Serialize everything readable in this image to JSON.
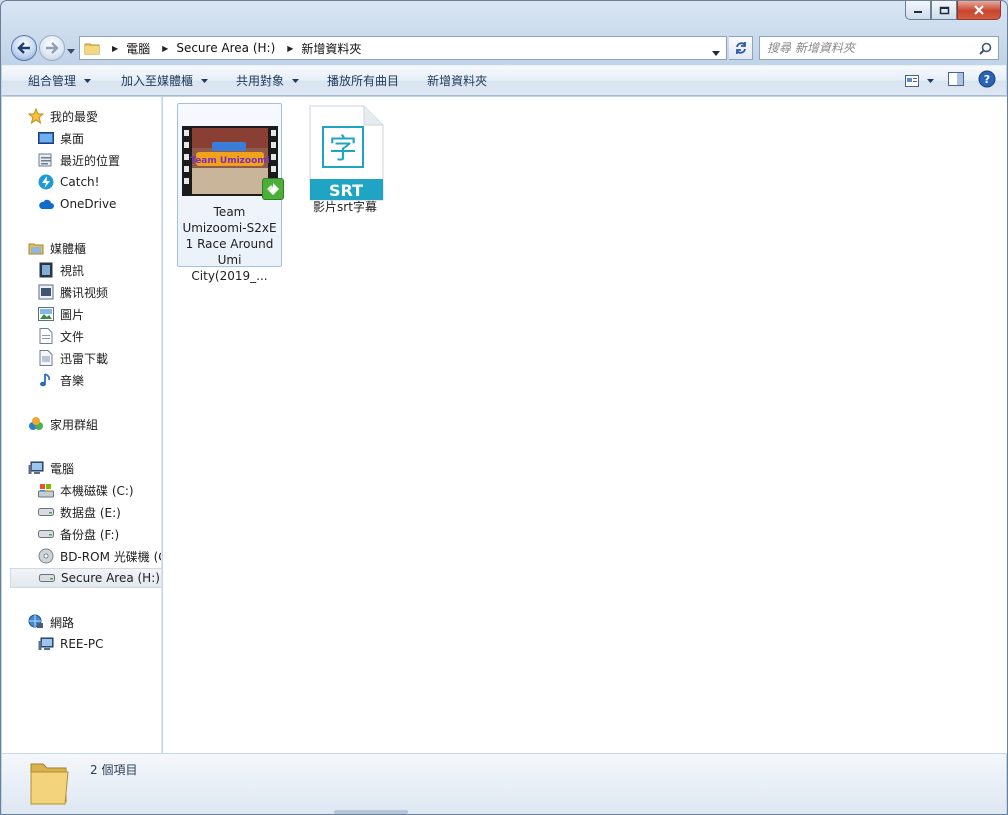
{
  "window": {
    "caption_buttons": [
      "minimize",
      "maximize",
      "close"
    ]
  },
  "address_bar": {
    "breadcrumbs": [
      "電腦",
      "Secure Area (H:)",
      "新增資料夾"
    ]
  },
  "search": {
    "placeholder": "搜尋 新增資料夾"
  },
  "toolbar": {
    "organize": "組合管理",
    "include_in_library": "加入至媒體櫃",
    "share_with": "共用對象",
    "play_all": "播放所有曲目",
    "new_folder": "新增資料夾"
  },
  "sidebar": {
    "favorites": {
      "label": "我的最愛",
      "items": [
        "桌面",
        "最近的位置",
        "Catch!",
        "OneDrive"
      ]
    },
    "libraries": {
      "label": "媒體櫃",
      "items": [
        "視訊",
        "騰讯视频",
        "圖片",
        "文件",
        "迅雷下載",
        "音樂"
      ]
    },
    "homegroup": {
      "label": "家用群組"
    },
    "computer": {
      "label": "電腦",
      "items": [
        "本機磁碟 (C:)",
        "数据盘 (E:)",
        "备份盘 (F:)",
        "BD-ROM 光碟機 (G:)",
        "Secure Area (H:)"
      ]
    },
    "network": {
      "label": "網路",
      "items": [
        "REE-PC"
      ]
    },
    "selected": "Secure Area (H:)"
  },
  "files": [
    {
      "name_lines": [
        "Team",
        "Umizoomi-S2xE",
        "1 Race Around",
        "Umi City(2019_..."
      ],
      "type": "video",
      "thumbnail_title": "Team Umizoomi"
    },
    {
      "name_lines": [
        "影片srt字幕"
      ],
      "type": "srt",
      "icon_glyph": "字",
      "icon_badge": "SRT"
    }
  ],
  "details": {
    "item_count": "2 個項目"
  },
  "colors": {
    "accent": "#1e395b",
    "srt": "#1fa4c4",
    "selection": "#cce4f7"
  }
}
